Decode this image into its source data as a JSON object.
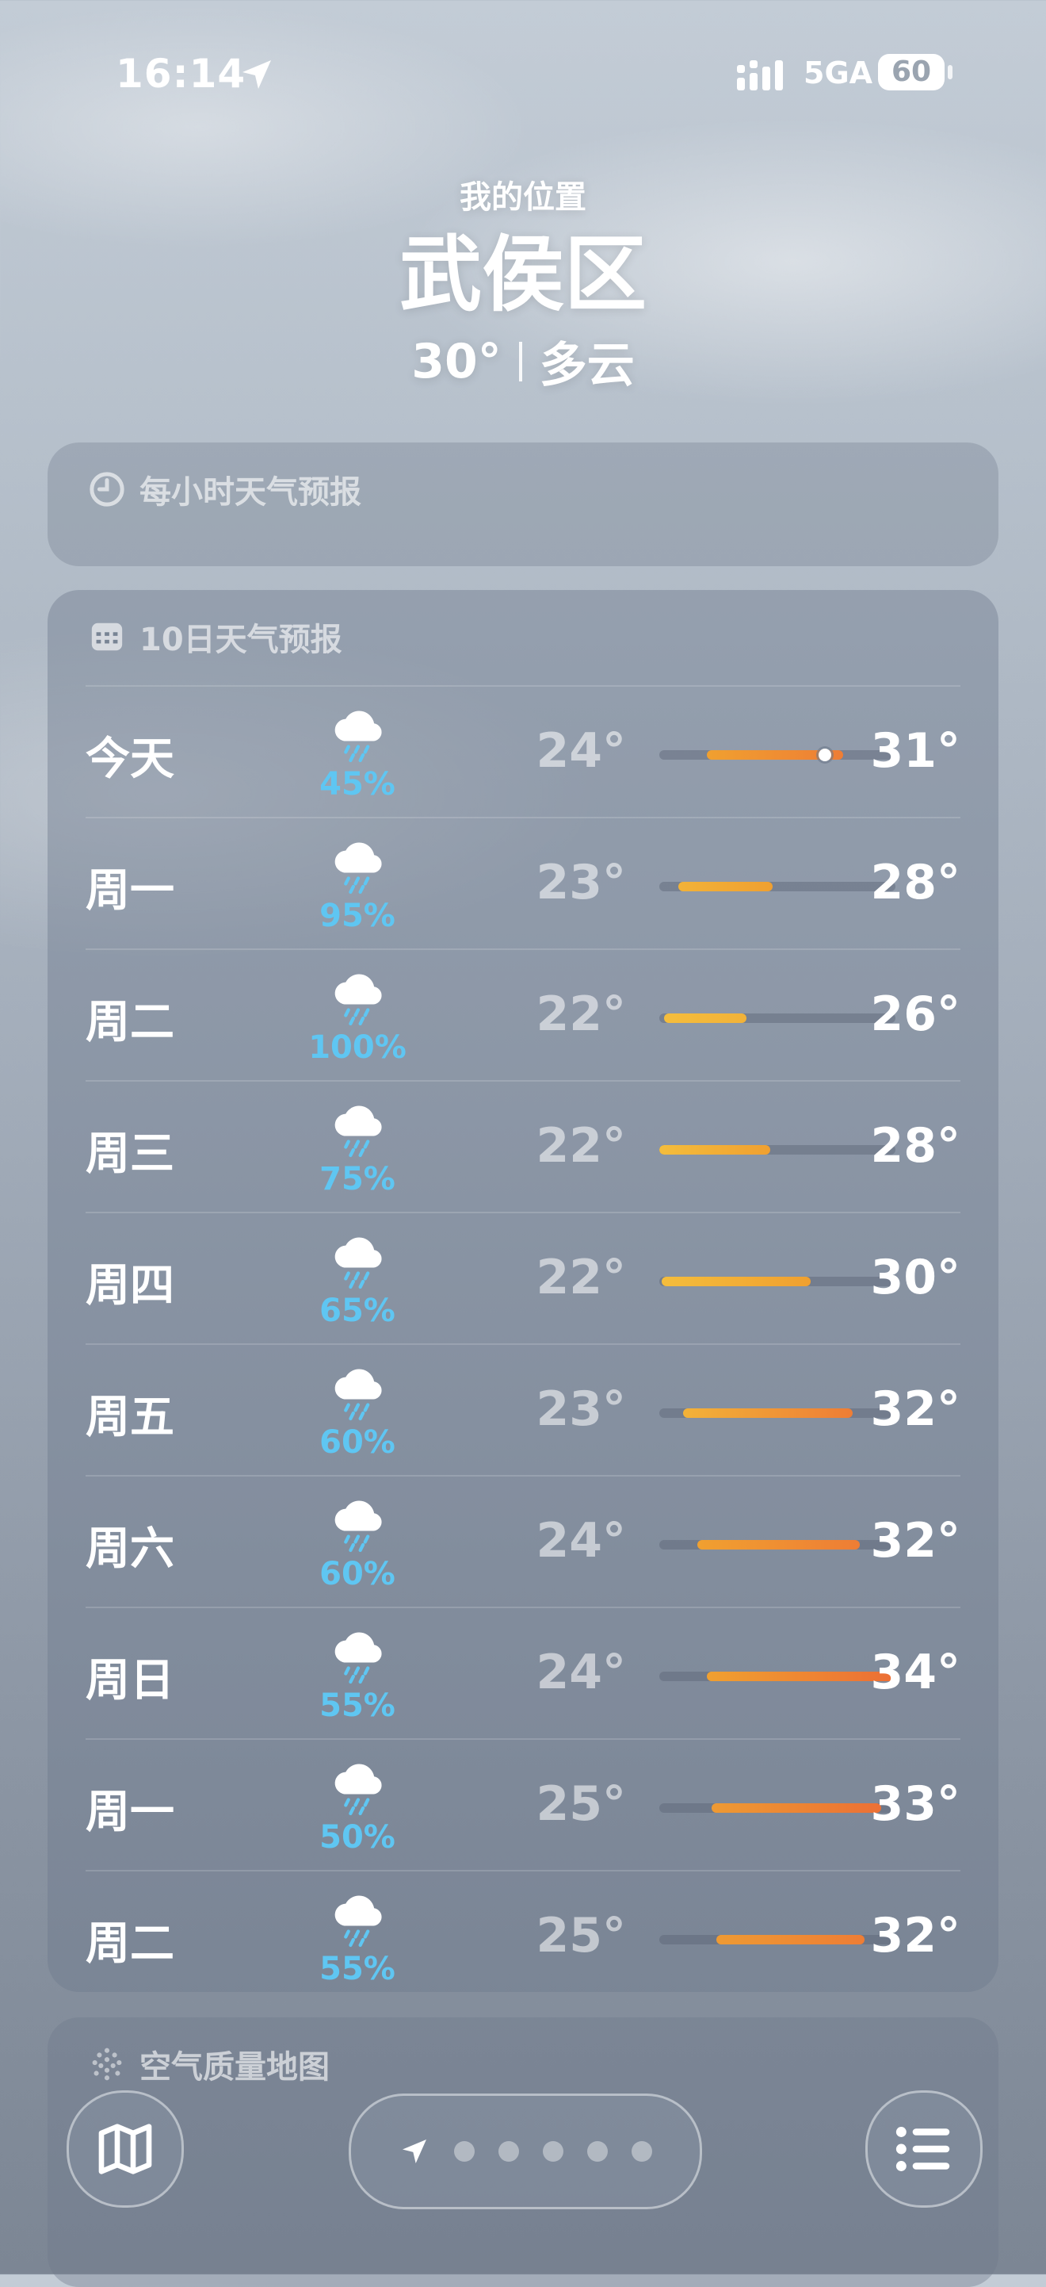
{
  "status_bar": {
    "time": "16:14",
    "network": "5GA",
    "battery": "60"
  },
  "header": {
    "location_label": "我的位置",
    "city": "武侯区",
    "temperature": "30°",
    "condition": "多云"
  },
  "hourly_card": {
    "title": "每小时天气预报",
    "icon": "clock-icon"
  },
  "daily_card": {
    "title": "10日天气预报",
    "icon": "calendar-icon",
    "days": [
      {
        "day": "今天",
        "icon": "cloud-rain-icon",
        "precip": "45%",
        "low": "24°",
        "high": "31°",
        "range": [
          0.2,
          0.78
        ],
        "current_marker": 0.7,
        "colors": [
          "#f0a030",
          "#ee7d35"
        ]
      },
      {
        "day": "周一",
        "icon": "cloud-rain-icon",
        "precip": "95%",
        "low": "23°",
        "high": "28°",
        "range": [
          0.08,
          0.48
        ],
        "colors": [
          "#f2b238",
          "#f0a030"
        ]
      },
      {
        "day": "周二",
        "icon": "cloud-rain-icon",
        "precip": "100%",
        "low": "22°",
        "high": "26°",
        "range": [
          0.02,
          0.37
        ],
        "colors": [
          "#f4bd3c",
          "#f2b238"
        ]
      },
      {
        "day": "周三",
        "icon": "cloud-rain-icon",
        "precip": "75%",
        "low": "22°",
        "high": "28°",
        "range": [
          0.0,
          0.47
        ],
        "colors": [
          "#f4bd3c",
          "#f0a030"
        ]
      },
      {
        "day": "周四",
        "icon": "cloud-rain-icon",
        "precip": "65%",
        "low": "22°",
        "high": "30°",
        "range": [
          0.01,
          0.64
        ],
        "colors": [
          "#f4bd3c",
          "#f0a030"
        ]
      },
      {
        "day": "周五",
        "icon": "cloud-rain-icon",
        "precip": "60%",
        "low": "23°",
        "high": "32°",
        "range": [
          0.1,
          0.82
        ],
        "colors": [
          "#f2b238",
          "#ee7d35"
        ]
      },
      {
        "day": "周六",
        "icon": "cloud-rain-icon",
        "precip": "60%",
        "low": "24°",
        "high": "32°",
        "range": [
          0.16,
          0.85
        ],
        "colors": [
          "#f0a030",
          "#ee7d35"
        ]
      },
      {
        "day": "周日",
        "icon": "cloud-rain-icon",
        "precip": "55%",
        "low": "24°",
        "high": "34°",
        "range": [
          0.2,
          1.0
        ],
        "colors": [
          "#f0a030",
          "#ec6e35"
        ]
      },
      {
        "day": "周一",
        "icon": "cloud-rain-icon",
        "precip": "50%",
        "low": "25°",
        "high": "33°",
        "range": [
          0.22,
          0.94
        ],
        "colors": [
          "#ee9a33",
          "#ec7035"
        ]
      },
      {
        "day": "周二",
        "icon": "cloud-rain-icon",
        "precip": "55%",
        "low": "25°",
        "high": "32°",
        "range": [
          0.24,
          0.87
        ],
        "colors": [
          "#ee9a33",
          "#ee7d35"
        ]
      }
    ]
  },
  "aqi_card": {
    "title": "空气质量地图",
    "icon": "aqi-dots-icon"
  },
  "bottom_bar": {
    "map_icon": "map-icon",
    "location_icon": "location-arrow-icon",
    "page_dots": 5,
    "list_icon": "list-icon"
  }
}
